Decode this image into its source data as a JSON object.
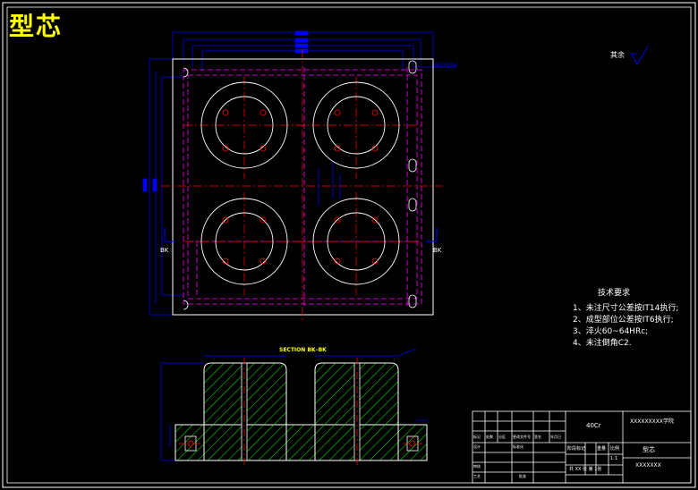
{
  "drawing": {
    "title": "型芯",
    "surface_note": "其余",
    "section_label": "SECTION BK–BK",
    "section_mark_left": "BK",
    "section_mark_right": "BK",
    "section_tag_top": "SECTION",
    "tech_requirements": {
      "heading": "技术要求",
      "items": [
        "1、未注尺寸公差按IT14执行;",
        "2、成型部位公差按IT6执行;",
        "3、淬火60~64HRc;",
        "4、未注倒角C2."
      ]
    },
    "title_block": {
      "material": "40Cr",
      "company": "XXXXXXXXX学院",
      "drawing_no": "XXXXXXX",
      "part_name": "型芯",
      "sheet": "共 XX 张  第 1张",
      "scale_label": "比例",
      "scale": "1:1",
      "weight_label": "重量",
      "stage_label": "阶段标记",
      "row_labels": [
        "标记",
        "处数",
        "分区",
        "更改文件号",
        "签名",
        "年月日"
      ],
      "design_label": "设计",
      "std_label": "标准化",
      "check_label": "审核",
      "process_label": "工艺",
      "approve_label": "批准"
    }
  },
  "colors": {
    "outline": "#ffffff",
    "dimension": "#0000ff",
    "hidden": "#ff00ff",
    "center": "#ff0000",
    "hatch": "#00ff00",
    "title": "#ffff00"
  }
}
